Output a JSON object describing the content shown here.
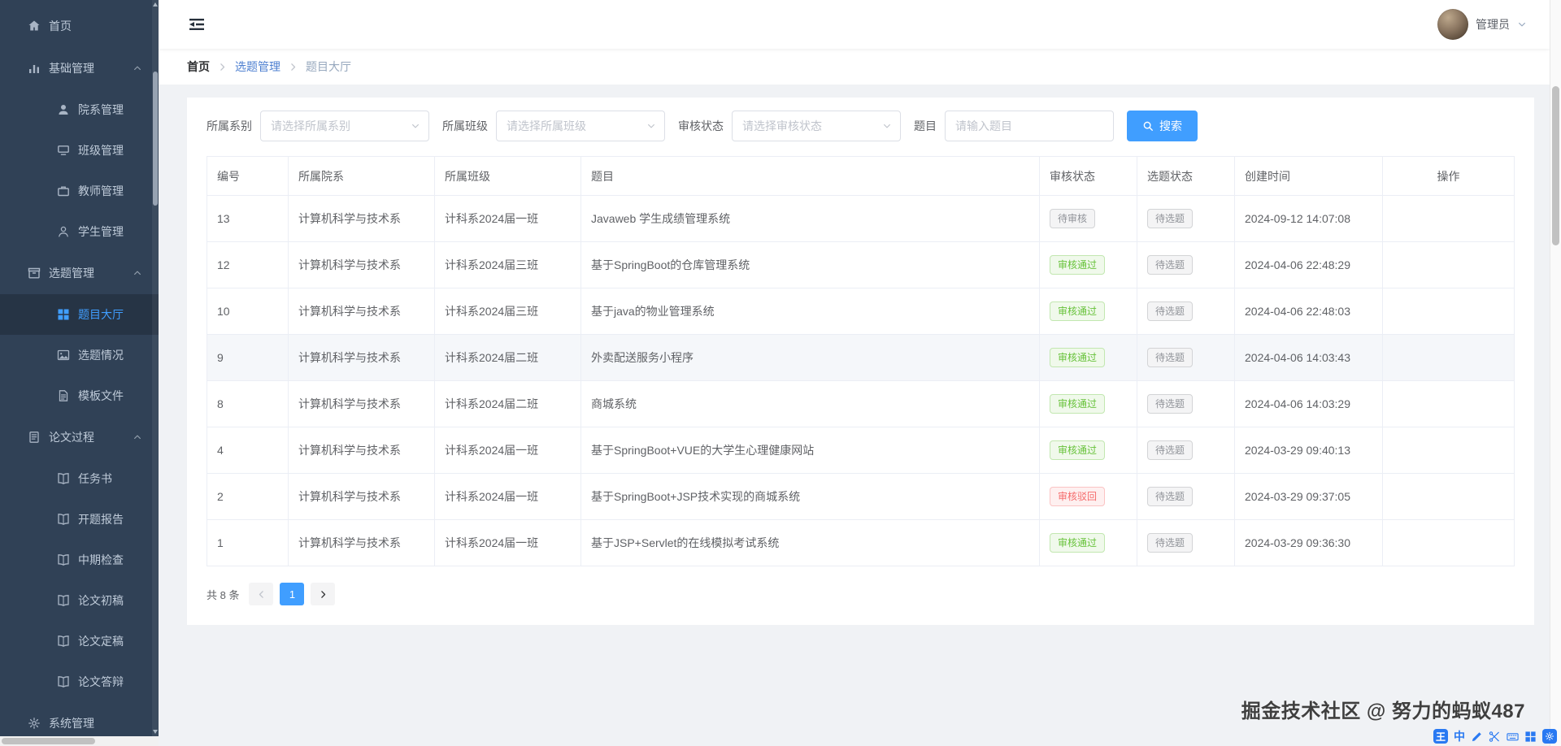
{
  "colors": {
    "accent": "#409eff",
    "success": "#67c23a",
    "danger": "#f56c6c",
    "info": "#909399",
    "sidebar_bg": "#304156"
  },
  "header": {
    "username": "管理员"
  },
  "sidebar": {
    "items": [
      {
        "label": "首页"
      },
      {
        "label": "基础管理"
      },
      {
        "label": "院系管理"
      },
      {
        "label": "班级管理"
      },
      {
        "label": "教师管理"
      },
      {
        "label": "学生管理"
      },
      {
        "label": "选题管理"
      },
      {
        "label": "题目大厅"
      },
      {
        "label": "选题情况"
      },
      {
        "label": "模板文件"
      },
      {
        "label": "论文过程"
      },
      {
        "label": "任务书"
      },
      {
        "label": "开题报告"
      },
      {
        "label": "中期检查"
      },
      {
        "label": "论文初稿"
      },
      {
        "label": "论文定稿"
      },
      {
        "label": "论文答辩"
      },
      {
        "label": "系统管理"
      }
    ]
  },
  "breadcrumb": {
    "items": [
      "首页",
      "选题管理",
      "题目大厅"
    ]
  },
  "filters": {
    "fields": [
      {
        "label": "所属系别",
        "placeholder": "请选择所属系别"
      },
      {
        "label": "所属班级",
        "placeholder": "请选择所属班级"
      },
      {
        "label": "审核状态",
        "placeholder": "请选择审核状态"
      },
      {
        "label": "题目",
        "placeholder": "请输入题目"
      }
    ],
    "search_label": "搜索"
  },
  "table": {
    "columns": [
      "编号",
      "所属院系",
      "所属班级",
      "题目",
      "审核状态",
      "选题状态",
      "创建时间",
      "操作"
    ],
    "rows": [
      {
        "id": "13",
        "dept": "计算机科学与技术系",
        "class": "计科系2024届一班",
        "topic": "Javaweb 学生成绩管理系统",
        "review": {
          "label": "待审核",
          "type": "info"
        },
        "selection": {
          "label": "待选题",
          "type": "info"
        },
        "created": "2024-09-12 14:07:08"
      },
      {
        "id": "12",
        "dept": "计算机科学与技术系",
        "class": "计科系2024届三班",
        "topic": "基于SpringBoot的仓库管理系统",
        "review": {
          "label": "审核通过",
          "type": "success"
        },
        "selection": {
          "label": "待选题",
          "type": "info"
        },
        "created": "2024-04-06 22:48:29"
      },
      {
        "id": "10",
        "dept": "计算机科学与技术系",
        "class": "计科系2024届三班",
        "topic": "基于java的物业管理系统",
        "review": {
          "label": "审核通过",
          "type": "success"
        },
        "selection": {
          "label": "待选题",
          "type": "info"
        },
        "created": "2024-04-06 22:48:03"
      },
      {
        "id": "9",
        "dept": "计算机科学与技术系",
        "class": "计科系2024届二班",
        "topic": "外卖配送服务小程序",
        "review": {
          "label": "审核通过",
          "type": "success"
        },
        "selection": {
          "label": "待选题",
          "type": "info"
        },
        "created": "2024-04-06 14:03:43"
      },
      {
        "id": "8",
        "dept": "计算机科学与技术系",
        "class": "计科系2024届二班",
        "topic": "商城系统",
        "review": {
          "label": "审核通过",
          "type": "success"
        },
        "selection": {
          "label": "待选题",
          "type": "info"
        },
        "created": "2024-04-06 14:03:29"
      },
      {
        "id": "4",
        "dept": "计算机科学与技术系",
        "class": "计科系2024届一班",
        "topic": "基于SpringBoot+VUE的大学生心理健康网站",
        "review": {
          "label": "审核通过",
          "type": "success"
        },
        "selection": {
          "label": "待选题",
          "type": "info"
        },
        "created": "2024-03-29 09:40:13"
      },
      {
        "id": "2",
        "dept": "计算机科学与技术系",
        "class": "计科系2024届一班",
        "topic": "基于SpringBoot+JSP技术实现的商城系统",
        "review": {
          "label": "审核驳回",
          "type": "danger"
        },
        "selection": {
          "label": "待选题",
          "type": "info"
        },
        "created": "2024-03-29 09:37:05"
      },
      {
        "id": "1",
        "dept": "计算机科学与技术系",
        "class": "计科系2024届一班",
        "topic": "基于JSP+Servlet的在线模拟考试系统",
        "review": {
          "label": "审核通过",
          "type": "success"
        },
        "selection": {
          "label": "待选题",
          "type": "info"
        },
        "created": "2024-03-29 09:36:30"
      }
    ]
  },
  "pagination": {
    "total": "共 8 条",
    "page": "1"
  },
  "watermark": "掘金技术社区 @ 努力的蚂蚁487",
  "ime": {
    "logo": "王",
    "mode": "中"
  }
}
